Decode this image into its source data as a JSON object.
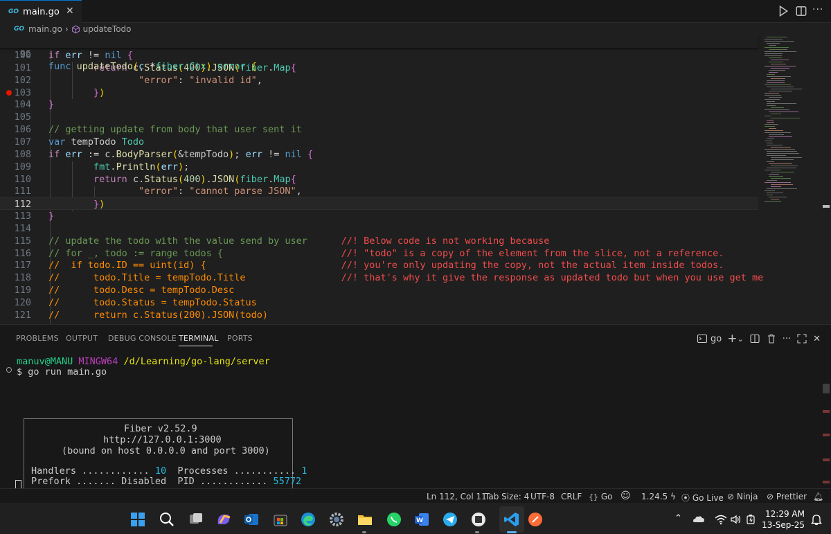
{
  "tab": {
    "icon": "GO",
    "file_name": "main.go",
    "close": "✕"
  },
  "breadcrumb": {
    "icon": "GO",
    "file": "main.go",
    "separator": "›",
    "symbol": "updateTodo"
  },
  "editor": {
    "sticky_line_number": "96",
    "sticky_code": "func updateTodo(c *fiber.Ctx) error {",
    "lines": [
      {
        "n": "100",
        "text": "    if err != nil {"
      },
      {
        "n": "101",
        "text": "        return c.Status(400).JSON(fiber.Map{"
      },
      {
        "n": "102",
        "text": "            \"error\": \"invalid id\","
      },
      {
        "n": "103",
        "text": "        })",
        "breakpoint": true
      },
      {
        "n": "104",
        "text": "    }"
      },
      {
        "n": "105",
        "text": ""
      },
      {
        "n": "106",
        "text": "    // getting update from body that user sent it"
      },
      {
        "n": "107",
        "text": "    var tempTodo Todo"
      },
      {
        "n": "108",
        "text": "    if err := c.BodyParser(&tempTodo); err != nil {"
      },
      {
        "n": "109",
        "text": "        fmt.Println(err);"
      },
      {
        "n": "110",
        "text": "        return c.Status(400).JSON(fiber.Map{"
      },
      {
        "n": "111",
        "text": "            \"error\": \"cannot parse JSON\","
      },
      {
        "n": "112",
        "text": "        })",
        "current": true
      },
      {
        "n": "113",
        "text": "    }"
      },
      {
        "n": "114",
        "text": ""
      },
      {
        "n": "115",
        "text": "    // update the todo with the value send by user      //! Below code is not working because"
      },
      {
        "n": "116",
        "text": "    // for _, todo := range todos {                     //! \"todo\" is a copy of the element from the slice, not a reference."
      },
      {
        "n": "117",
        "text": "    //  if todo.ID == uint(id) {                        //! you're only updating the copy, not the actual item inside todos."
      },
      {
        "n": "118",
        "text": "    //      todo.Title = tempTodo.Title                 //! that's why it give the response as updated todo but when you use get me"
      },
      {
        "n": "119",
        "text": "    //      todo.Desc = tempTodo.Desc"
      },
      {
        "n": "120",
        "text": "    //      todo.Status = tempTodo.Status"
      },
      {
        "n": "121",
        "text": "    //      return c.Status(200).JSON(todo)"
      }
    ]
  },
  "panel": {
    "tabs": [
      "PROBLEMS",
      "OUTPUT",
      "DEBUG CONSOLE",
      "TERMINAL",
      "PORTS"
    ],
    "active_tab": "TERMINAL",
    "terminal_name": "go",
    "plus": "+",
    "chevron": "⌄",
    "ellipsis": "···",
    "close": "✕"
  },
  "terminal": {
    "user": "manuv@MANU",
    "env": "MINGW64",
    "path": "/d/Learning/go-lang/server",
    "prompt": "$",
    "command": "go run main.go",
    "fiber_title": "Fiber v2.52.9",
    "fiber_url": "http://127.0.0.1:3000",
    "fiber_bound": "(bound on host 0.0.0.0 and port 3000)",
    "handlers_label": "Handlers ............",
    "handlers_value": "10",
    "processes_label": "Processes ...........",
    "processes_value": "1",
    "prefork_label": "Prefork .......",
    "prefork_value": "Disabled",
    "pid_label": "PID ............",
    "pid_value": "55772"
  },
  "statusbar": {
    "position": "Ln 112, Col 11",
    "tab_size": "Tab Size: 4",
    "encoding": "UTF-8",
    "eol": "CRLF",
    "language": "Go",
    "go_version": "1.24.5",
    "go_live": "Go Live",
    "ninja": "Ninja",
    "prettier": "Prettier"
  },
  "taskbar": {
    "time": "12:29 AM",
    "date": "13-Sep-25"
  },
  "colors": {
    "accent": "#0078d4",
    "breakpoint": "#e51400",
    "error_comment": "#f14c4c"
  }
}
